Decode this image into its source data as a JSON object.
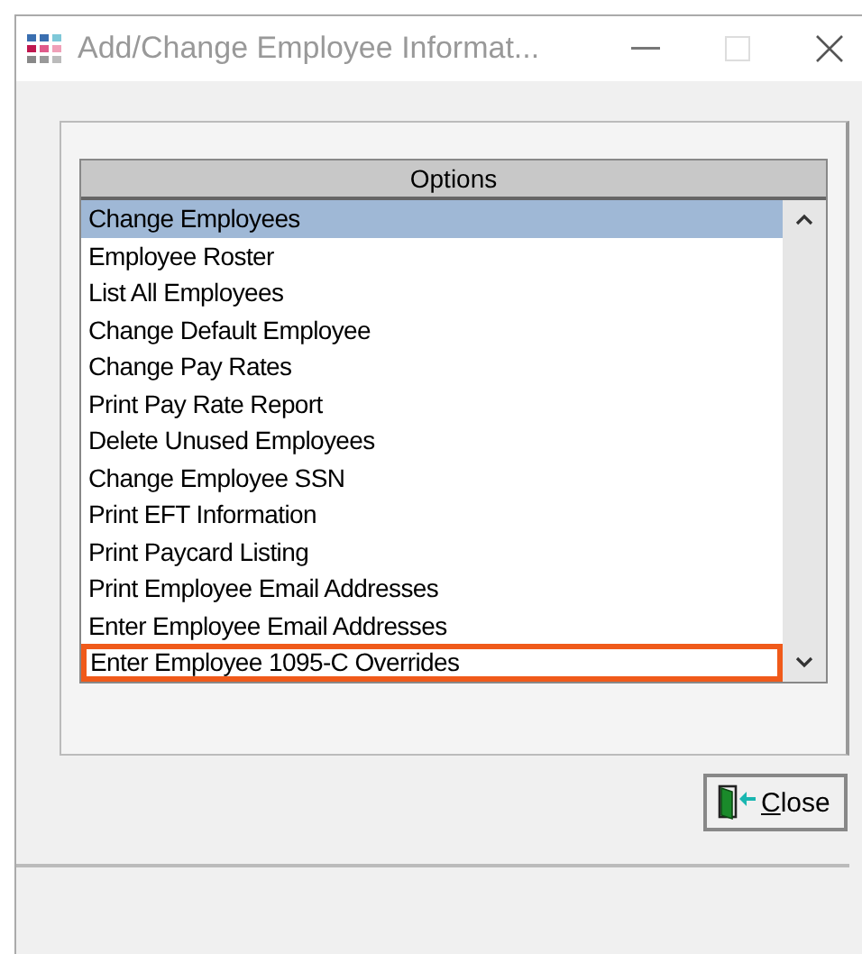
{
  "window": {
    "title": "Add/Change Employee Informat...",
    "active": false
  },
  "options_list": {
    "header": "Options",
    "items": [
      {
        "label": "Change Employees",
        "selected": true,
        "outlined": false
      },
      {
        "label": "Employee Roster",
        "selected": false,
        "outlined": false
      },
      {
        "label": "List All Employees",
        "selected": false,
        "outlined": false
      },
      {
        "label": "Change Default Employee",
        "selected": false,
        "outlined": false
      },
      {
        "label": "Change Pay Rates",
        "selected": false,
        "outlined": false
      },
      {
        "label": "Print Pay Rate Report",
        "selected": false,
        "outlined": false
      },
      {
        "label": "Delete Unused Employees",
        "selected": false,
        "outlined": false
      },
      {
        "label": "Change Employee SSN",
        "selected": false,
        "outlined": false
      },
      {
        "label": "Print EFT Information",
        "selected": false,
        "outlined": false
      },
      {
        "label": "Print Paycard Listing",
        "selected": false,
        "outlined": false
      },
      {
        "label": "Print Employee Email Addresses",
        "selected": false,
        "outlined": false
      },
      {
        "label": "Enter Employee Email Addresses",
        "selected": false,
        "outlined": false
      },
      {
        "label": "Enter Employee 1095-C Overrides",
        "selected": false,
        "outlined": true
      }
    ]
  },
  "close_button": {
    "label": "Close"
  }
}
